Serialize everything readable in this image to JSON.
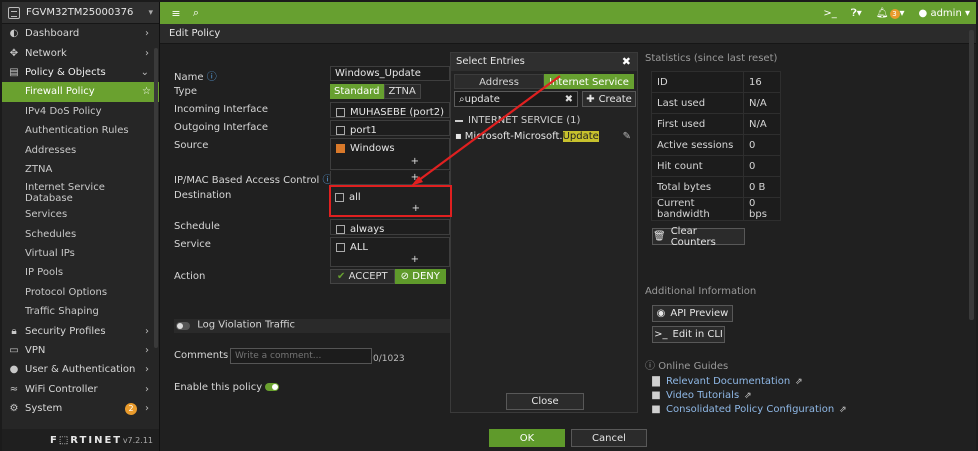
{
  "sidebar": {
    "device": "FGVM32TM25000376",
    "items": [
      {
        "label": "Dashboard",
        "icon": "dashboard-icon",
        "glyph": "◐"
      },
      {
        "label": "Network",
        "icon": "network-icon",
        "glyph": "✥"
      },
      {
        "label": "Policy & Objects",
        "icon": "policy-icon",
        "glyph": "▤"
      },
      {
        "label": "Firewall Policy"
      },
      {
        "label": "IPv4 DoS Policy"
      },
      {
        "label": "Authentication Rules"
      },
      {
        "label": "Addresses"
      },
      {
        "label": "ZTNA"
      },
      {
        "label": "Internet Service"
      },
      {
        "label": "Database"
      },
      {
        "label": "Services"
      },
      {
        "label": "Schedules"
      },
      {
        "label": "Virtual IPs"
      },
      {
        "label": "IP Pools"
      },
      {
        "label": "Protocol Options"
      },
      {
        "label": "Traffic Shaping"
      },
      {
        "label": "Security Profiles",
        "icon": "lock-icon",
        "glyph": "🔒"
      },
      {
        "label": "VPN",
        "icon": "vpn-icon",
        "glyph": "▭"
      },
      {
        "label": "User & Authentication",
        "icon": "user-icon",
        "glyph": "👤"
      },
      {
        "label": "WiFi Controller",
        "icon": "wifi-icon",
        "glyph": "≈"
      },
      {
        "label": "System",
        "icon": "gear-icon",
        "glyph": "⚙",
        "badge": "2"
      }
    ],
    "brand": "F⬚RTINET",
    "version": "v7.2.11"
  },
  "topbar": {
    "admin": "admin",
    "bell_count": "3"
  },
  "main": {
    "title": "Edit Policy",
    "labels": {
      "name": "Name",
      "type": "Type",
      "incoming": "Incoming Interface",
      "outgoing": "Outgoing Interface",
      "source": "Source",
      "ipmac": "IP/MAC Based Access Control",
      "destination": "Destination",
      "schedule": "Schedule",
      "service": "Service",
      "action": "Action",
      "log": "Log Violation Traffic",
      "comments": "Comments",
      "enable": "Enable this policy"
    },
    "values": {
      "name": "Windows_Update",
      "type_standard": "Standard",
      "type_ztna": "ZTNA",
      "incoming": "MUHASEBE (port2)",
      "outgoing": "port1",
      "source": "Windows",
      "destination": "all",
      "schedule": "always",
      "service": "ALL",
      "accept": "ACCEPT",
      "deny": "DENY",
      "comment_placeholder": "Write a comment...",
      "comment_count": "0/1023"
    },
    "ok": "OK",
    "cancel": "Cancel"
  },
  "panel": {
    "title": "Select Entries",
    "tab_address": "Address",
    "tab_internet": "Internet Service",
    "search": "update",
    "create": "Create",
    "group": "INTERNET SERVICE (1)",
    "item_prefix": "Microsoft-Microsoft.",
    "item_highlight": "Update",
    "close": "Close"
  },
  "stats": {
    "title": "Statistics (since last reset)",
    "rows": [
      {
        "k": "ID",
        "v": "16"
      },
      {
        "k": "Last used",
        "v": "N/A"
      },
      {
        "k": "First used",
        "v": "N/A"
      },
      {
        "k": "Active sessions",
        "v": "0"
      },
      {
        "k": "Hit count",
        "v": "0"
      },
      {
        "k": "Total bytes",
        "v": "0 B"
      },
      {
        "k": "Current bandwidth",
        "v": "0 bps"
      }
    ],
    "clear": "Clear Counters"
  },
  "additional": {
    "title": "Additional Information",
    "api": "API Preview",
    "cli": "Edit in CLI",
    "guides": "Online Guides",
    "links": [
      "Relevant Documentation",
      "Video Tutorials",
      "Consolidated Policy Configuration"
    ]
  },
  "colors": {
    "accent": "#67a030",
    "highlight": "#c7c12d",
    "annotation": "#e02020"
  }
}
